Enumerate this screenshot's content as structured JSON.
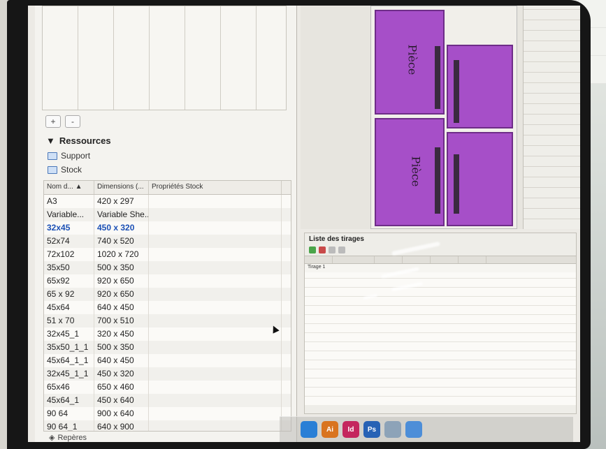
{
  "resources": {
    "header": "Ressources",
    "plus_label": "+",
    "minus_label": "-",
    "items": [
      {
        "label": "Support",
        "icon": "support-icon"
      },
      {
        "label": "Stock",
        "icon": "stock-icon"
      }
    ],
    "columns": [
      "Nom d...",
      "Dimensions (...",
      "Propriétés Stock"
    ],
    "rows": [
      [
        "A3",
        "420 x 297"
      ],
      [
        "Variable...",
        "Variable She..."
      ],
      [
        "32x45",
        "450 x 320"
      ],
      [
        "52x74",
        "740 x 520"
      ],
      [
        "72x102",
        "1020 x 720"
      ],
      [
        "35x50",
        "500 x 350"
      ],
      [
        "65x92",
        "920 x 650"
      ],
      [
        "65 x 92",
        "920 x 650"
      ],
      [
        "45x64",
        "640 x 450"
      ],
      [
        "51 x 70",
        "700 x 510"
      ],
      [
        "32x45_1",
        "320 x 450"
      ],
      [
        "35x50_1_1",
        "500 x 350"
      ],
      [
        "45x64_1_1",
        "640 x 450"
      ],
      [
        "32x45_1_1",
        "450 x 320"
      ],
      [
        "65x46",
        "650 x 460"
      ],
      [
        "45x64_1",
        "450 x 640"
      ],
      [
        "90 64",
        "900 x 640"
      ],
      [
        "90 64_1",
        "640 x 900"
      ]
    ],
    "selected_row": 2,
    "reperes": "Repères"
  },
  "canvas": {
    "pieces": [
      {
        "label": "Pièce"
      },
      {
        "label": "Pièce"
      }
    ],
    "piece_color": "#a64fc8"
  },
  "tirages": {
    "title": "Liste des tirages",
    "row_label": "Tirage 1"
  },
  "dock": {
    "icons": [
      {
        "name": "safari-icon",
        "text": "",
        "color": "#2a7fd6"
      },
      {
        "name": "illustrator-icon",
        "text": "Ai",
        "color": "#d9741f"
      },
      {
        "name": "indesign-icon",
        "text": "Id",
        "color": "#c4265e"
      },
      {
        "name": "photoshop-icon",
        "text": "Ps",
        "color": "#2762b5"
      },
      {
        "name": "preview-icon",
        "text": "",
        "color": "#8da3b8"
      },
      {
        "name": "finder-icon",
        "text": "",
        "color": "#4d8ed8"
      }
    ]
  }
}
